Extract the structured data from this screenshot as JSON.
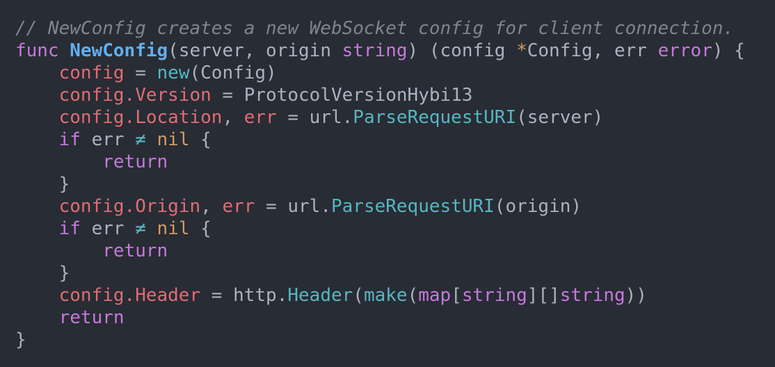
{
  "code": {
    "lines": [
      [
        {
          "t": "// NewConfig creates a new WebSocket config for client connection.",
          "c": "cmt"
        }
      ],
      [
        {
          "t": "func ",
          "c": "kw"
        },
        {
          "t": "NewConfig",
          "c": "fn"
        },
        {
          "t": "(server, origin ",
          "c": "plain"
        },
        {
          "t": "string",
          "c": "ty"
        },
        {
          "t": ") (config ",
          "c": "plain"
        },
        {
          "t": "*",
          "c": "nil"
        },
        {
          "t": "Config, err ",
          "c": "plain"
        },
        {
          "t": "error",
          "c": "ty"
        },
        {
          "t": ") {",
          "c": "plain"
        }
      ],
      [
        {
          "t": "    ",
          "c": "plain"
        },
        {
          "t": "config",
          "c": "var"
        },
        {
          "t": " = ",
          "c": "plain"
        },
        {
          "t": "new",
          "c": "bi"
        },
        {
          "t": "(Config)",
          "c": "plain"
        }
      ],
      [
        {
          "t": "    ",
          "c": "plain"
        },
        {
          "t": "config.Version",
          "c": "var"
        },
        {
          "t": " = ProtocolVersionHybi13",
          "c": "plain"
        }
      ],
      [
        {
          "t": "    ",
          "c": "plain"
        },
        {
          "t": "config.Location",
          "c": "var"
        },
        {
          "t": ", ",
          "c": "plain"
        },
        {
          "t": "err",
          "c": "var"
        },
        {
          "t": " = url.",
          "c": "plain"
        },
        {
          "t": "ParseRequestURI",
          "c": "bi"
        },
        {
          "t": "(server)",
          "c": "plain"
        }
      ],
      [
        {
          "t": "    ",
          "c": "plain"
        },
        {
          "t": "if",
          "c": "kw"
        },
        {
          "t": " err ",
          "c": "plain"
        },
        {
          "t": "≠",
          "c": "op"
        },
        {
          "t": " ",
          "c": "plain"
        },
        {
          "t": "nil",
          "c": "nil"
        },
        {
          "t": " {",
          "c": "plain"
        }
      ],
      [
        {
          "t": "        ",
          "c": "plain"
        },
        {
          "t": "return",
          "c": "kw"
        }
      ],
      [
        {
          "t": "    }",
          "c": "plain"
        }
      ],
      [
        {
          "t": "    ",
          "c": "plain"
        },
        {
          "t": "config.Origin",
          "c": "var"
        },
        {
          "t": ", ",
          "c": "plain"
        },
        {
          "t": "err",
          "c": "var"
        },
        {
          "t": " = url.",
          "c": "plain"
        },
        {
          "t": "ParseRequestURI",
          "c": "bi"
        },
        {
          "t": "(origin)",
          "c": "plain"
        }
      ],
      [
        {
          "t": "    ",
          "c": "plain"
        },
        {
          "t": "if",
          "c": "kw"
        },
        {
          "t": " err ",
          "c": "plain"
        },
        {
          "t": "≠",
          "c": "op"
        },
        {
          "t": " ",
          "c": "plain"
        },
        {
          "t": "nil",
          "c": "nil"
        },
        {
          "t": " {",
          "c": "plain"
        }
      ],
      [
        {
          "t": "        ",
          "c": "plain"
        },
        {
          "t": "return",
          "c": "kw"
        }
      ],
      [
        {
          "t": "    }",
          "c": "plain"
        }
      ],
      [
        {
          "t": "    ",
          "c": "plain"
        },
        {
          "t": "config.Header",
          "c": "var"
        },
        {
          "t": " = http.",
          "c": "plain"
        },
        {
          "t": "Header",
          "c": "bi"
        },
        {
          "t": "(",
          "c": "plain"
        },
        {
          "t": "make",
          "c": "bi"
        },
        {
          "t": "(",
          "c": "plain"
        },
        {
          "t": "map",
          "c": "kw"
        },
        {
          "t": "[",
          "c": "plain"
        },
        {
          "t": "string",
          "c": "ty"
        },
        {
          "t": "][]",
          "c": "plain"
        },
        {
          "t": "string",
          "c": "ty"
        },
        {
          "t": "))",
          "c": "plain"
        }
      ],
      [
        {
          "t": "    ",
          "c": "plain"
        },
        {
          "t": "return",
          "c": "kw"
        }
      ],
      [
        {
          "t": "}",
          "c": "plain"
        }
      ]
    ]
  },
  "theme": {
    "background": "#282c34",
    "comment": "#7f848e",
    "keyword": "#c678dd",
    "function": "#61afef",
    "variable": "#e06c75",
    "builtin": "#56b6c2",
    "constant": "#d19a66",
    "text": "#abb2bf"
  }
}
